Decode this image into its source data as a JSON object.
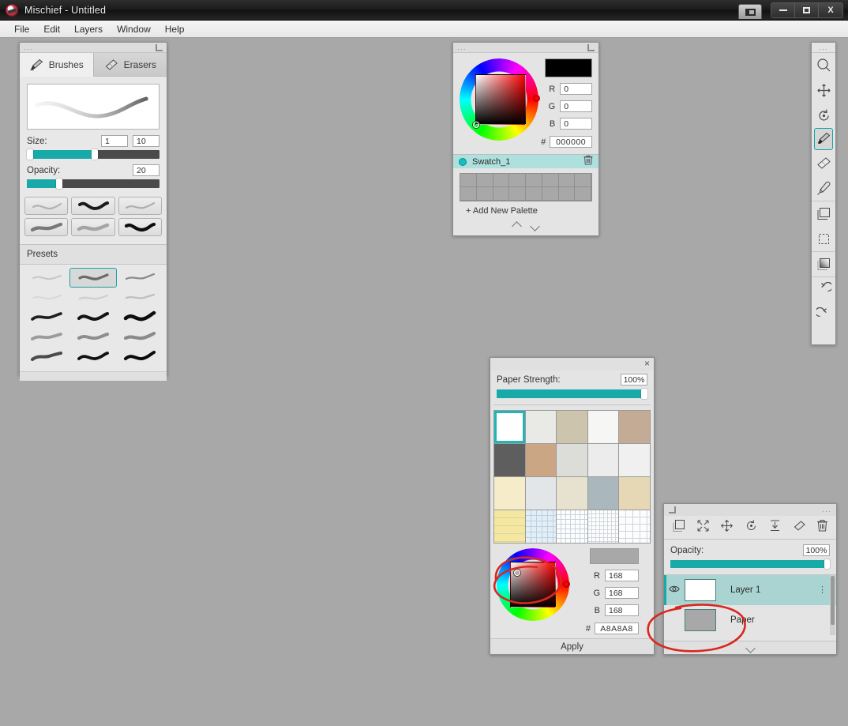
{
  "window": {
    "title": "Mischief - Untitled",
    "logo_icon": "mischief-logo-icon",
    "pin_icon": "pin-window-icon",
    "minimize_icon": "minimize-icon",
    "maximize_icon": "maximize-icon",
    "close_label": "X"
  },
  "menubar": {
    "items": [
      {
        "label": "File"
      },
      {
        "label": "Edit"
      },
      {
        "label": "Layers"
      },
      {
        "label": "Window"
      },
      {
        "label": "Help"
      }
    ]
  },
  "brush_panel": {
    "header_dots": "...",
    "dock_icon": "dock-panel-icon",
    "tabs": [
      {
        "label": "Brushes",
        "icon": "brush-icon",
        "active": true
      },
      {
        "label": "Erasers",
        "icon": "eraser-icon",
        "active": false
      }
    ],
    "preview_name": "brush-stroke-preview",
    "size": {
      "label": "Size:",
      "min_value": "1",
      "max_value": "10",
      "fill_pct": 53,
      "knob_left_pct": 0,
      "knob_right_pct": 49
    },
    "opacity": {
      "label": "Opacity:",
      "value": "20",
      "fill_pct": 25,
      "knob_pct": 22
    },
    "brush_cells": [
      {
        "name": "brush-thumb-1"
      },
      {
        "name": "brush-thumb-2"
      },
      {
        "name": "brush-thumb-3"
      },
      {
        "name": "brush-thumb-4"
      },
      {
        "name": "brush-thumb-5"
      },
      {
        "name": "brush-thumb-6"
      }
    ],
    "presets_label": "Presets",
    "preset_cells": [
      {
        "name": "preset-1",
        "selected": false
      },
      {
        "name": "preset-2",
        "selected": true
      },
      {
        "name": "preset-3",
        "selected": false
      },
      {
        "name": "preset-4",
        "selected": false
      },
      {
        "name": "preset-5",
        "selected": false
      },
      {
        "name": "preset-6",
        "selected": false
      },
      {
        "name": "preset-7",
        "selected": false
      },
      {
        "name": "preset-8",
        "selected": false
      },
      {
        "name": "preset-9",
        "selected": false
      },
      {
        "name": "preset-10",
        "selected": false
      },
      {
        "name": "preset-11",
        "selected": false
      },
      {
        "name": "preset-12",
        "selected": false
      },
      {
        "name": "preset-13",
        "selected": false
      },
      {
        "name": "preset-14",
        "selected": false
      },
      {
        "name": "preset-15",
        "selected": false
      }
    ]
  },
  "color_panel": {
    "header_dots": "...",
    "dock_icon": "dock-panel-icon",
    "current_color": "#000000",
    "r_label": "R",
    "r_value": "0",
    "g_label": "G",
    "g_value": "0",
    "b_label": "B",
    "b_value": "0",
    "hex_label": "#",
    "hex_value": "000000",
    "swatch_group_name": "Swatch_1",
    "delete_icon": "trash-icon",
    "add_palette_label": "+ Add New Palette",
    "palette_swatch_color": "#a8a8a8",
    "scroll_up_icon": "chevron-up-icon",
    "scroll_down_icon": "chevron-down-icon"
  },
  "paper_dialog": {
    "close_label": "×",
    "strength_label": "Paper Strength:",
    "strength_value": "100%",
    "textures": [
      {
        "name": "texture-plain-white",
        "color": "#ffffff",
        "selected": true
      },
      {
        "name": "texture-rough-white",
        "color": "#e9e9e5",
        "selected": false
      },
      {
        "name": "texture-tan-card",
        "color": "#cdc4ae",
        "selected": false
      },
      {
        "name": "texture-smooth-white",
        "color": "#f6f6f4",
        "selected": false
      },
      {
        "name": "texture-brown-kraft",
        "color": "#c4ab95",
        "selected": false
      },
      {
        "name": "texture-dark-grey",
        "color": "#5e5e5e",
        "selected": false
      },
      {
        "name": "texture-tan-brown",
        "color": "#cba685",
        "selected": false
      },
      {
        "name": "texture-light-grey",
        "color": "#dcdcd8",
        "selected": false
      },
      {
        "name": "texture-speckled-white",
        "color": "#ececed",
        "selected": false
      },
      {
        "name": "texture-fleck-white",
        "color": "#f0f0f0",
        "selected": false
      },
      {
        "name": "texture-cream-fiber",
        "color": "#f6ecc9",
        "selected": false
      },
      {
        "name": "texture-cool-white",
        "color": "#e2e6e8",
        "selected": false
      },
      {
        "name": "texture-beige-grain",
        "color": "#e6e2cf",
        "selected": false
      },
      {
        "name": "texture-blue-grey-rough",
        "color": "#aab7bd",
        "selected": false
      },
      {
        "name": "texture-sand",
        "color": "#e6d8b4",
        "selected": false
      },
      {
        "name": "texture-legal-yellow",
        "color": "#f6e7a0",
        "selected": false
      },
      {
        "name": "texture-blue-graph",
        "color": "#e4eef5",
        "selected": false
      },
      {
        "name": "texture-grid-white",
        "color": "#fdfdfd",
        "selected": false
      },
      {
        "name": "texture-fine-grid",
        "color": "#fdfdfd",
        "selected": false
      },
      {
        "name": "texture-wide-grid",
        "color": "#fdfdfd",
        "selected": false
      }
    ],
    "paper_color": "#a8a8a8",
    "r_label": "R",
    "r_value": "168",
    "g_label": "G",
    "g_value": "168",
    "b_label": "B",
    "b_value": "168",
    "hex_label": "#",
    "hex_value": "A8A8A8",
    "apply_label": "Apply"
  },
  "layers_panel": {
    "dock_icon": "dock-panel-icon",
    "header_dots": "...",
    "tools": [
      {
        "name": "new-layer-icon"
      },
      {
        "name": "transform-icon"
      },
      {
        "name": "move-icon"
      },
      {
        "name": "rotate-icon"
      },
      {
        "name": "merge-down-icon"
      },
      {
        "name": "erase-layer-icon"
      },
      {
        "name": "delete-layer-icon"
      }
    ],
    "opacity_label": "Opacity:",
    "opacity_value": "100%",
    "layers": [
      {
        "name": "Layer 1",
        "selected": true,
        "visible": true,
        "thumb": "#ffffff"
      },
      {
        "name": "Paper",
        "selected": false,
        "visible": false,
        "thumb": "#a8a8a8"
      }
    ],
    "collapse_icon": "chevron-down-icon",
    "visibility_icon": "eye-icon",
    "kebab_icon": "kebab-menu-icon"
  },
  "toolbar": {
    "header_dots": "...",
    "tools": [
      {
        "name": "zoom-tool",
        "active": false
      },
      {
        "name": "pan-tool",
        "active": false
      },
      {
        "name": "rotate-canvas-tool",
        "active": false
      },
      {
        "name": "brush-tool",
        "active": true
      },
      {
        "name": "eraser-tool",
        "active": false
      },
      {
        "name": "eyedropper-tool",
        "active": false
      },
      {
        "name": "rectangle-tool",
        "active": false
      },
      {
        "name": "marquee-select-tool",
        "active": false
      },
      {
        "name": "gradient-tool",
        "active": false
      },
      {
        "name": "undo-tool",
        "active": false
      },
      {
        "name": "redo-tool",
        "active": false
      }
    ]
  },
  "annotations": {
    "color": "#d8281e",
    "marks": [
      {
        "name": "annotation-ellipse-color-wheel"
      },
      {
        "name": "annotation-ellipse-paper-layer"
      }
    ]
  },
  "canvas": {
    "background_color": "#a8a8a8"
  }
}
